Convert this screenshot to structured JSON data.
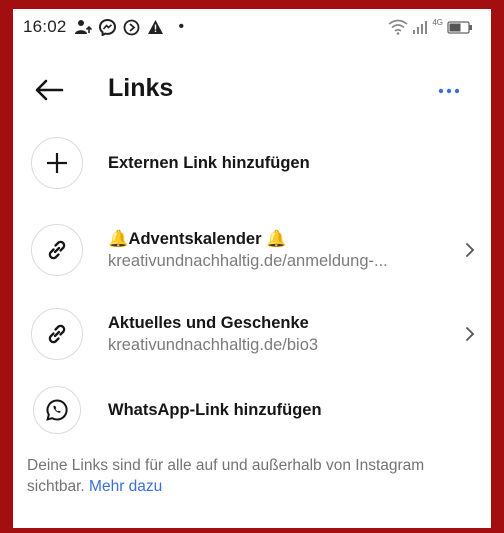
{
  "status_bar": {
    "time": "16:02",
    "dot": "•",
    "network_badge": "4G",
    "left_icons": [
      "person-upload-icon",
      "messenger-icon",
      "do-not-disturb-icon",
      "warning-icon"
    ],
    "right_icons": [
      "wifi-icon",
      "signal-icon",
      "battery-icon"
    ]
  },
  "header": {
    "title": "Links",
    "back_icon": "arrow-left-icon",
    "more_icon": "more-dots-icon"
  },
  "items": [
    {
      "title": "Externen Link hinzufügen",
      "subtitle": "",
      "icon": "plus-icon",
      "chevron": false
    },
    {
      "title": "🔔Adventskalender 🔔",
      "subtitle": "kreativundnachhaltig.de/anmeldung-...",
      "icon": "link-icon",
      "chevron": true
    },
    {
      "title": "Aktuelles und Geschenke",
      "subtitle": "kreativundnachhaltig.de/bio3",
      "icon": "link-icon",
      "chevron": true
    },
    {
      "title": "WhatsApp-Link hinzufügen",
      "subtitle": "",
      "icon": "whatsapp-icon",
      "chevron": false
    }
  ],
  "footer": {
    "text": "Deine Links sind für alle auf und außerhalb von Instagram sichtbar.",
    "link": "Mehr dazu"
  },
  "colors": {
    "frame": "#a30f10",
    "accent_link": "#3a6fd8",
    "more_dots": "#3b6fd9",
    "bell": "#f2b51d"
  }
}
